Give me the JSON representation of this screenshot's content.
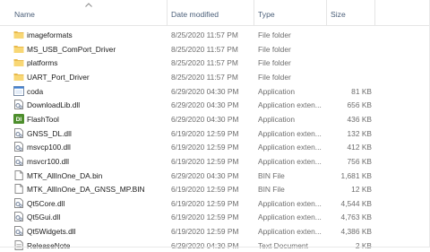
{
  "columns": {
    "name": "Name",
    "date": "Date modified",
    "type": "Type",
    "size": "Size"
  },
  "files": [
    {
      "name": "imageformats",
      "date": "8/25/2020 11:57 PM",
      "type": "File folder",
      "size": "",
      "icon": "folder-icon"
    },
    {
      "name": "MS_USB_ComPort_Driver",
      "date": "8/25/2020 11:57 PM",
      "type": "File folder",
      "size": "",
      "icon": "folder-icon"
    },
    {
      "name": "platforms",
      "date": "8/25/2020 11:57 PM",
      "type": "File folder",
      "size": "",
      "icon": "folder-icon"
    },
    {
      "name": "UART_Port_Driver",
      "date": "8/25/2020 11:57 PM",
      "type": "File folder",
      "size": "",
      "icon": "folder-icon"
    },
    {
      "name": "coda",
      "date": "6/29/2020 04:30 PM",
      "type": "Application",
      "size": "81 KB",
      "icon": "application-icon"
    },
    {
      "name": "DownloadLib.dll",
      "date": "6/29/2020 04:30 PM",
      "type": "Application exten...",
      "size": "656 KB",
      "icon": "dll-icon"
    },
    {
      "name": "FlashTool",
      "date": "6/29/2020 04:30 PM",
      "type": "Application",
      "size": "436 KB",
      "icon": "flashtool-icon"
    },
    {
      "name": "GNSS_DL.dll",
      "date": "6/19/2020 12:59 PM",
      "type": "Application exten...",
      "size": "132 KB",
      "icon": "dll-icon"
    },
    {
      "name": "msvcp100.dll",
      "date": "6/19/2020 12:59 PM",
      "type": "Application exten...",
      "size": "412 KB",
      "icon": "dll-icon"
    },
    {
      "name": "msvcr100.dll",
      "date": "6/19/2020 12:59 PM",
      "type": "Application exten...",
      "size": "756 KB",
      "icon": "dll-icon"
    },
    {
      "name": "MTK_AllInOne_DA.bin",
      "date": "6/29/2020 04:30 PM",
      "type": "BIN File",
      "size": "1,681 KB",
      "icon": "file-icon"
    },
    {
      "name": "MTK_AllInOne_DA_GNSS_MP.BIN",
      "date": "6/19/2020 12:59 PM",
      "type": "BIN File",
      "size": "12 KB",
      "icon": "file-icon"
    },
    {
      "name": "Qt5Core.dll",
      "date": "6/19/2020 12:59 PM",
      "type": "Application exten...",
      "size": "4,544 KB",
      "icon": "dll-icon"
    },
    {
      "name": "Qt5Gui.dll",
      "date": "6/19/2020 12:59 PM",
      "type": "Application exten...",
      "size": "4,763 KB",
      "icon": "dll-icon"
    },
    {
      "name": "Qt5Widgets.dll",
      "date": "6/19/2020 12:59 PM",
      "type": "Application exten...",
      "size": "4,386 KB",
      "icon": "dll-icon"
    },
    {
      "name": "ReleaseNote",
      "date": "6/29/2020 04:30 PM",
      "type": "Text Document",
      "size": "2 KB",
      "icon": "text-document-icon"
    }
  ]
}
